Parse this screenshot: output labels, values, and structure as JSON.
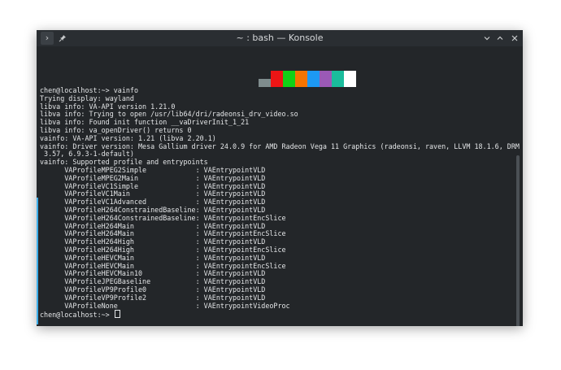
{
  "window": {
    "title": "~ : bash — Konsole"
  },
  "titlebar_icons": {
    "menu": "chevron-right-icon",
    "pin": "pin-icon",
    "minimize": "chevron-down-icon",
    "maximize": "chevron-up-icon",
    "close": "close-icon"
  },
  "colors": {
    "background": "#232629",
    "text": "#e4e6e8",
    "titlebar": "#2a2e32",
    "accent": "#3daee9",
    "swatches": [
      "#7f8c8d",
      "#ed1515",
      "#11d116",
      "#f67400",
      "#1d99f3",
      "#9b59b6",
      "#1abc9c",
      "#ffffff"
    ]
  },
  "terminal": {
    "lines": [
      "chen@localhost:~> vainfo",
      "Trying display: wayland",
      "libva info: VA-API version 1.21.0",
      "libva info: Trying to open /usr/lib64/dri/radeonsi_drv_video.so",
      "libva info: Found init function __vaDriverInit_1_21",
      "libva info: va_openDriver() returns 0",
      "vainfo: VA-API version: 1.21 (libva 2.20.1)",
      "vainfo: Driver version: Mesa Gallium driver 24.0.9 for AMD Radeon Vega 11 Graphics (radeonsi, raven, LLVM 18.1.6, DRM",
      " 3.57, 6.9.3-1-default)",
      "vainfo: Supported profile and entrypoints",
      "      VAProfileMPEG2Simple            : VAEntrypointVLD",
      "      VAProfileMPEG2Main              : VAEntrypointVLD",
      "      VAProfileVC1Simple              : VAEntrypointVLD",
      "      VAProfileVC1Main                : VAEntrypointVLD",
      "      VAProfileVC1Advanced            : VAEntrypointVLD",
      "      VAProfileH264ConstrainedBaseline: VAEntrypointVLD",
      "      VAProfileH264ConstrainedBaseline: VAEntrypointEncSlice",
      "      VAProfileH264Main               : VAEntrypointVLD",
      "      VAProfileH264Main               : VAEntrypointEncSlice",
      "      VAProfileH264High               : VAEntrypointVLD",
      "      VAProfileH264High               : VAEntrypointEncSlice",
      "      VAProfileHEVCMain               : VAEntrypointVLD",
      "      VAProfileHEVCMain               : VAEntrypointEncSlice",
      "      VAProfileHEVCMain10             : VAEntrypointVLD",
      "      VAProfileJPEGBaseline           : VAEntrypointVLD",
      "      VAProfileVP9Profile0            : VAEntrypointVLD",
      "      VAProfileVP9Profile2            : VAEntrypointVLD",
      "      VAProfileNone                   : VAEntrypointVideoProc"
    ],
    "prompt": "chen@localhost:~> "
  }
}
